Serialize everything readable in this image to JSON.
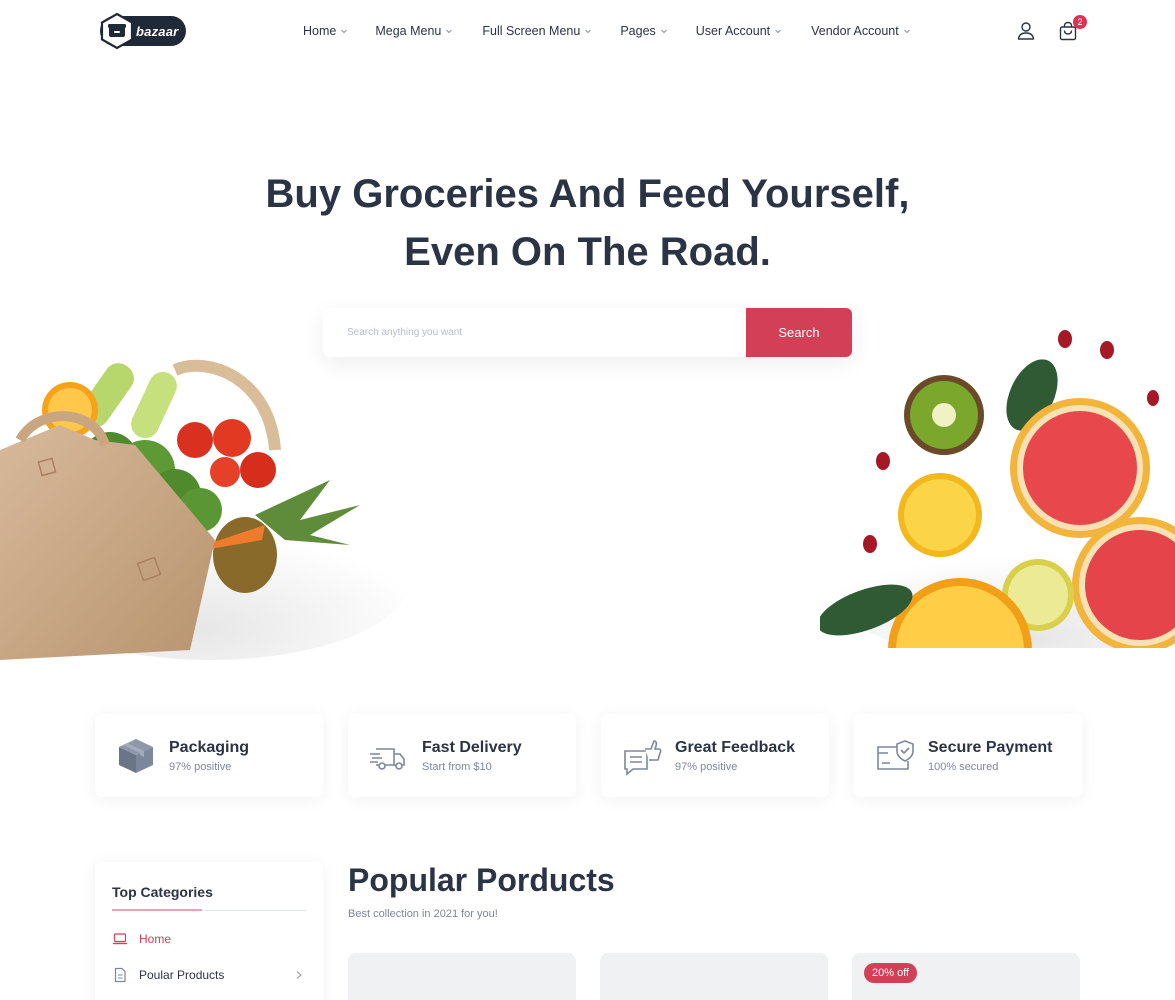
{
  "brand": {
    "logo_text": "bazaar"
  },
  "nav": {
    "items": [
      {
        "label": "Home"
      },
      {
        "label": "Mega Menu"
      },
      {
        "label": "Full Screen Menu"
      },
      {
        "label": "Pages"
      },
      {
        "label": "User Account"
      },
      {
        "label": "Vendor Account"
      }
    ],
    "cart_count": "2"
  },
  "hero": {
    "title_line1": "Buy Groceries And Feed Yourself,",
    "title_line2": "Even On The Road.",
    "search_placeholder": "Search anything you want",
    "search_button": "Search"
  },
  "services": [
    {
      "title": "Packaging",
      "subtitle": "97% positive",
      "icon": "box-icon"
    },
    {
      "title": "Fast Delivery",
      "subtitle": "Start from $10",
      "icon": "truck-icon"
    },
    {
      "title": "Great Feedback",
      "subtitle": "97% positive",
      "icon": "feedback-icon"
    },
    {
      "title": "Secure Payment",
      "subtitle": "100% secured",
      "icon": "secure-card-icon"
    }
  ],
  "categories": {
    "title": "Top Categories",
    "items": [
      {
        "label": "Home",
        "icon": "laptop-icon",
        "active": true
      },
      {
        "label": "Poular Products",
        "icon": "document-icon",
        "active": false
      }
    ]
  },
  "popular": {
    "title": "Popular Porducts",
    "subtitle": "Best collection in 2021 for you!",
    "badge": "20% off"
  },
  "colors": {
    "primary": "#d23f57",
    "text": "#2b3445",
    "muted": "#7d879c"
  }
}
